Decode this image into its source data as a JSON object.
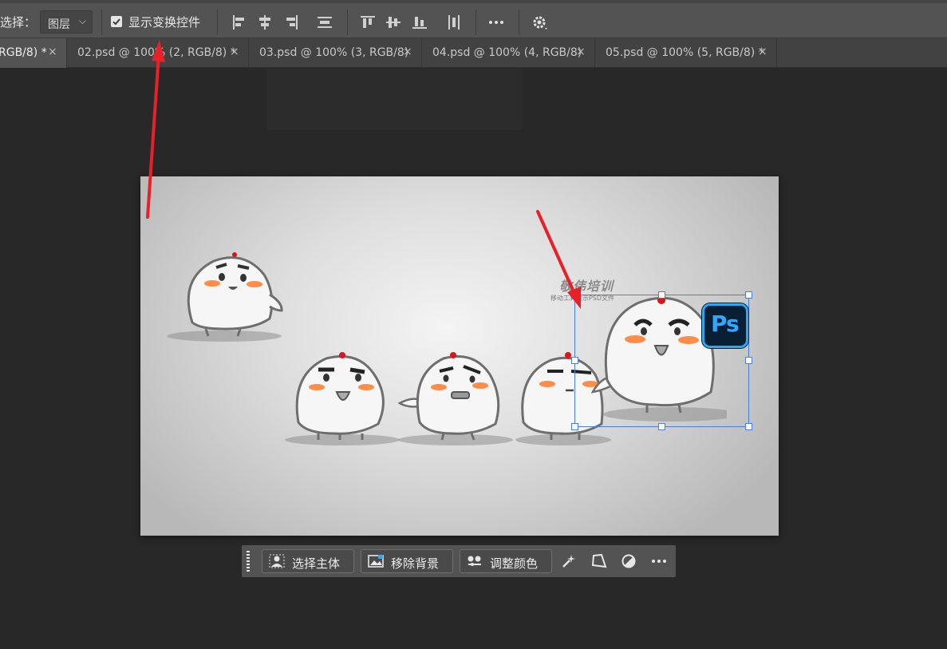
{
  "options_bar": {
    "select_label": "选择：",
    "select_value": "图层",
    "show_transform_label": "显示变换控件",
    "show_transform_checked": true,
    "icons": [
      "align-left-icon",
      "align-horizontal-center-icon",
      "align-right-icon",
      "distribute-vertical-icon",
      "align-top-icon",
      "align-vertical-center-icon",
      "align-bottom-icon",
      "distribute-horizontal-icon",
      "more-icon",
      "gear-icon"
    ]
  },
  "tabs": [
    {
      "label": "RGB/8) *",
      "close": "×",
      "active": true
    },
    {
      "label": "02.psd @ 100% (2, RGB/8) *",
      "close": "×",
      "active": false
    },
    {
      "label": "03.psd @ 100% (3, RGB/8)",
      "close": "×",
      "active": false
    },
    {
      "label": "04.psd @ 100% (4, RGB/8)",
      "close": "×",
      "active": false
    },
    {
      "label": "05.psd @ 100% (5, RGB/8) *",
      "close": "×",
      "active": false
    }
  ],
  "canvas": {
    "watermark": "敬伟培训",
    "watermark_sub": "移动工具显示PSD文件",
    "ps_logo": "Ps"
  },
  "taskbar": {
    "select_subject": "选择主体",
    "remove_background": "移除背景",
    "adjust_color": "调整颜色",
    "icons": [
      "sparkle-brush-icon",
      "perspective-icon",
      "contrast-icon",
      "more-icon"
    ]
  },
  "colors": {
    "annotation_arrow": "#e8202a",
    "selection": "#4a7fe0",
    "ps_blue": "#31a8ff"
  }
}
